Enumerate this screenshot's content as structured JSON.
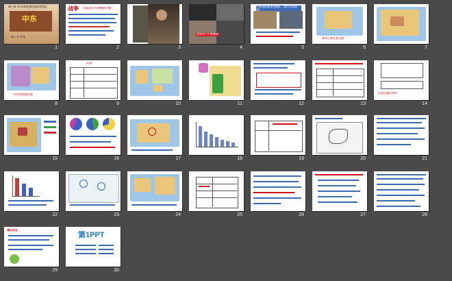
{
  "colors": {
    "background": "#4a4a4a",
    "slide": "#ffffff",
    "number": "#eeeeee",
    "accent_red": "#d0101a",
    "map_blue": "#9fc6e6",
    "map_land": "#e9c67a"
  },
  "slides": [
    {
      "n": "1",
      "title": "中东",
      "subtitle": "第八章 东半球其他的国家和地区",
      "caption": "第一节 中东"
    },
    {
      "n": "2",
      "title": "战争",
      "text": "是谁给人们带来的灾难？"
    },
    {
      "n": "3"
    },
    {
      "n": "4",
      "text": "战争给人们带来的"
    },
    {
      "n": "5",
      "text": "世界战乱最多的地区，他们为何而战？"
    },
    {
      "n": "6",
      "text": "两洋三洲五海之地"
    },
    {
      "n": "7"
    },
    {
      "n": "8",
      "text": "中东的地理位置"
    },
    {
      "n": "9",
      "text": "石油"
    },
    {
      "n": "10"
    },
    {
      "n": "11"
    },
    {
      "n": "12"
    },
    {
      "n": "13"
    },
    {
      "n": "14",
      "text": "石油主要分布在"
    },
    {
      "n": "15"
    },
    {
      "n": "16"
    },
    {
      "n": "17"
    },
    {
      "n": "18"
    },
    {
      "n": "19"
    },
    {
      "n": "20"
    },
    {
      "n": "21"
    },
    {
      "n": "22"
    },
    {
      "n": "23"
    },
    {
      "n": "24"
    },
    {
      "n": "25"
    },
    {
      "n": "26"
    },
    {
      "n": "27"
    },
    {
      "n": "28"
    },
    {
      "n": "29",
      "text": "课后作业"
    },
    {
      "n": "30",
      "text": "第1PPT"
    }
  ]
}
